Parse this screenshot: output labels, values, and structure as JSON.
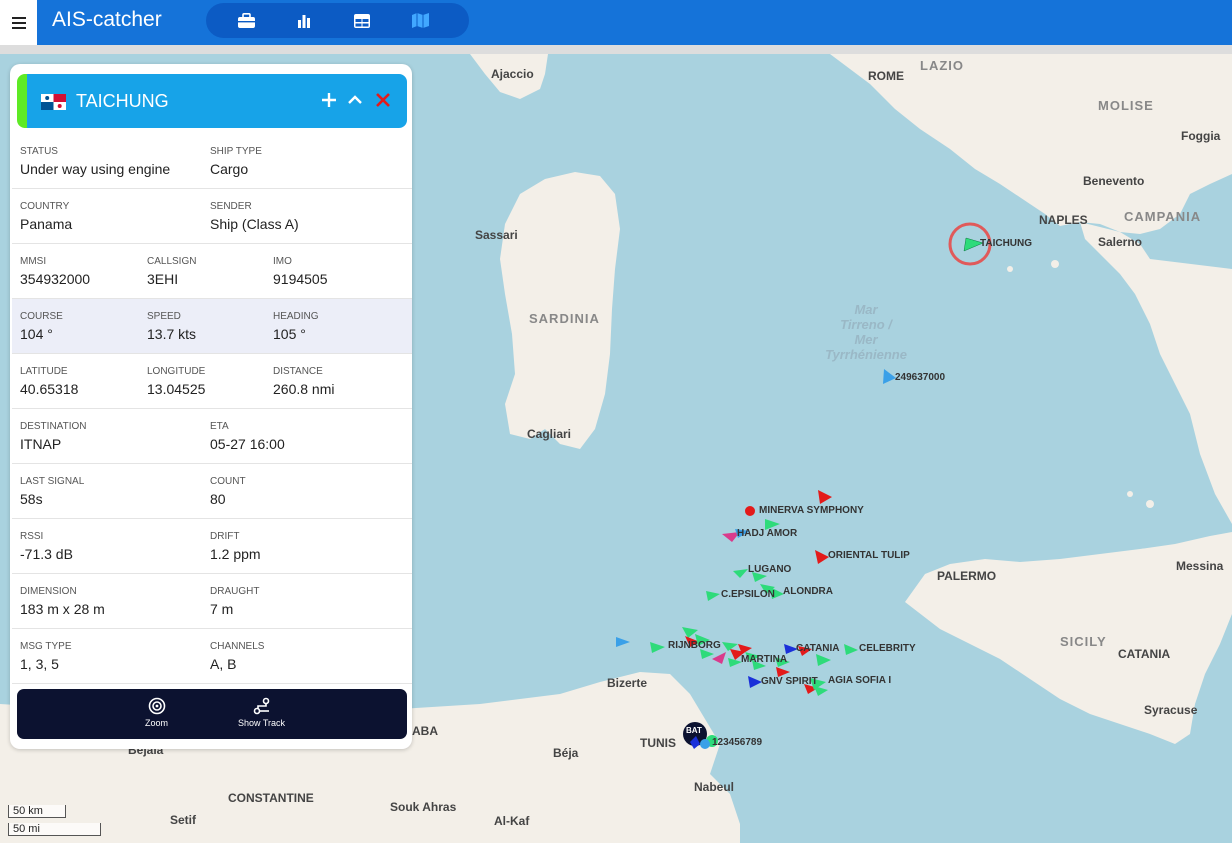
{
  "app": {
    "title": "AIS-catcher"
  },
  "nav": {
    "tabs": [
      "briefcase-icon",
      "bar-chart-icon",
      "table-icon",
      "map-icon"
    ]
  },
  "ship": {
    "name": "TAICHUNG",
    "flag": "Panama",
    "fields": {
      "status": {
        "label": "STATUS",
        "value": "Under way using engine"
      },
      "ship_type": {
        "label": "SHIP TYPE",
        "value": "Cargo"
      },
      "country": {
        "label": "COUNTRY",
        "value": "Panama"
      },
      "sender": {
        "label": "SENDER",
        "value": "Ship (Class A)"
      },
      "mmsi": {
        "label": "MMSI",
        "value": "354932000"
      },
      "callsign": {
        "label": "CALLSIGN",
        "value": "3EHI"
      },
      "imo": {
        "label": "IMO",
        "value": "9194505"
      },
      "course": {
        "label": "COURSE",
        "value": "104 °"
      },
      "speed": {
        "label": "SPEED",
        "value": "13.7 kts"
      },
      "heading": {
        "label": "HEADING",
        "value": "105 °"
      },
      "latitude": {
        "label": "LATITUDE",
        "value": "40.65318"
      },
      "longitude": {
        "label": "LONGITUDE",
        "value": "13.04525"
      },
      "distance": {
        "label": "DISTANCE",
        "value": "260.8 nmi"
      },
      "destination": {
        "label": "DESTINATION",
        "value": "ITNAP"
      },
      "eta": {
        "label": "ETA",
        "value": "05-27 16:00"
      },
      "last_signal": {
        "label": "LAST SIGNAL",
        "value": "58s"
      },
      "count": {
        "label": "COUNT",
        "value": "80"
      },
      "rssi": {
        "label": "RSSI",
        "value": "-71.3 dB"
      },
      "drift": {
        "label": "DRIFT",
        "value": "1.2 ppm"
      },
      "dimension": {
        "label": "DIMENSION",
        "value": "183 m x 28 m"
      },
      "draught": {
        "label": "DRAUGHT",
        "value": "7 m"
      },
      "msg_type": {
        "label": "MSG TYPE",
        "value": "1, 3, 5"
      },
      "channels": {
        "label": "CHANNELS",
        "value": "A, B"
      }
    },
    "actions": {
      "zoom": "Zoom",
      "show_track": "Show Track"
    }
  },
  "map": {
    "places": {
      "ajaccio": "Ajaccio",
      "rome": "ROME",
      "lazio": "LAZIO",
      "molise": "MOLISE",
      "foggia": "Foggia",
      "benevento": "Benevento",
      "naples": "NAPLES",
      "campania": "CAMPANIA",
      "salerno": "Salerno",
      "sassari": "Sassari",
      "sardinia": "SARDINIA",
      "cagliari": "Cagliari",
      "palermo": "PALERMO",
      "messina": "Messina",
      "sicily": "SICILY",
      "catania": "CATANIA",
      "syracuse": "Syracuse",
      "bizerte": "Bizerte",
      "tunis": "TUNIS",
      "beja": "Béja",
      "bejaia": "Bejaia",
      "aba": "ABA",
      "constantine": "CONSTANTINE",
      "souk_ahras": "Souk Ahras",
      "setif": "Setif",
      "al_kaf": "Al-Kaf",
      "nabeul": "Nabeul"
    },
    "sea_name": [
      "Mar",
      "Tirreno /",
      "Mer",
      "Tyrrhénienne"
    ],
    "ship_labels": {
      "taichung": "TAICHUNG",
      "s249637000": "249637000",
      "minerva": "MINERVA SYMPHONY",
      "hadj": "HADJ AMOR",
      "oriental": "ORIENTAL TULIP",
      "lugano": "LUGANO",
      "alondra": "ALONDRA",
      "epsilon": "C.EPSILON",
      "rijnborg": "RIJNBORG",
      "catania_ship": "CATANIA",
      "celebrity": "CELEBRITY",
      "martina": "MARTINA",
      "gnv": "GNV SPIRIT",
      "agia": "AGIA SOFIA I",
      "s123456789": "123456789",
      "cluster": "BAT"
    },
    "scale": {
      "km": "50 km",
      "mi": "50 mi"
    }
  },
  "colors": {
    "topbar": "#1573d9",
    "panel_header": "#17a3e8",
    "selected_ring": "#e05a5a"
  }
}
